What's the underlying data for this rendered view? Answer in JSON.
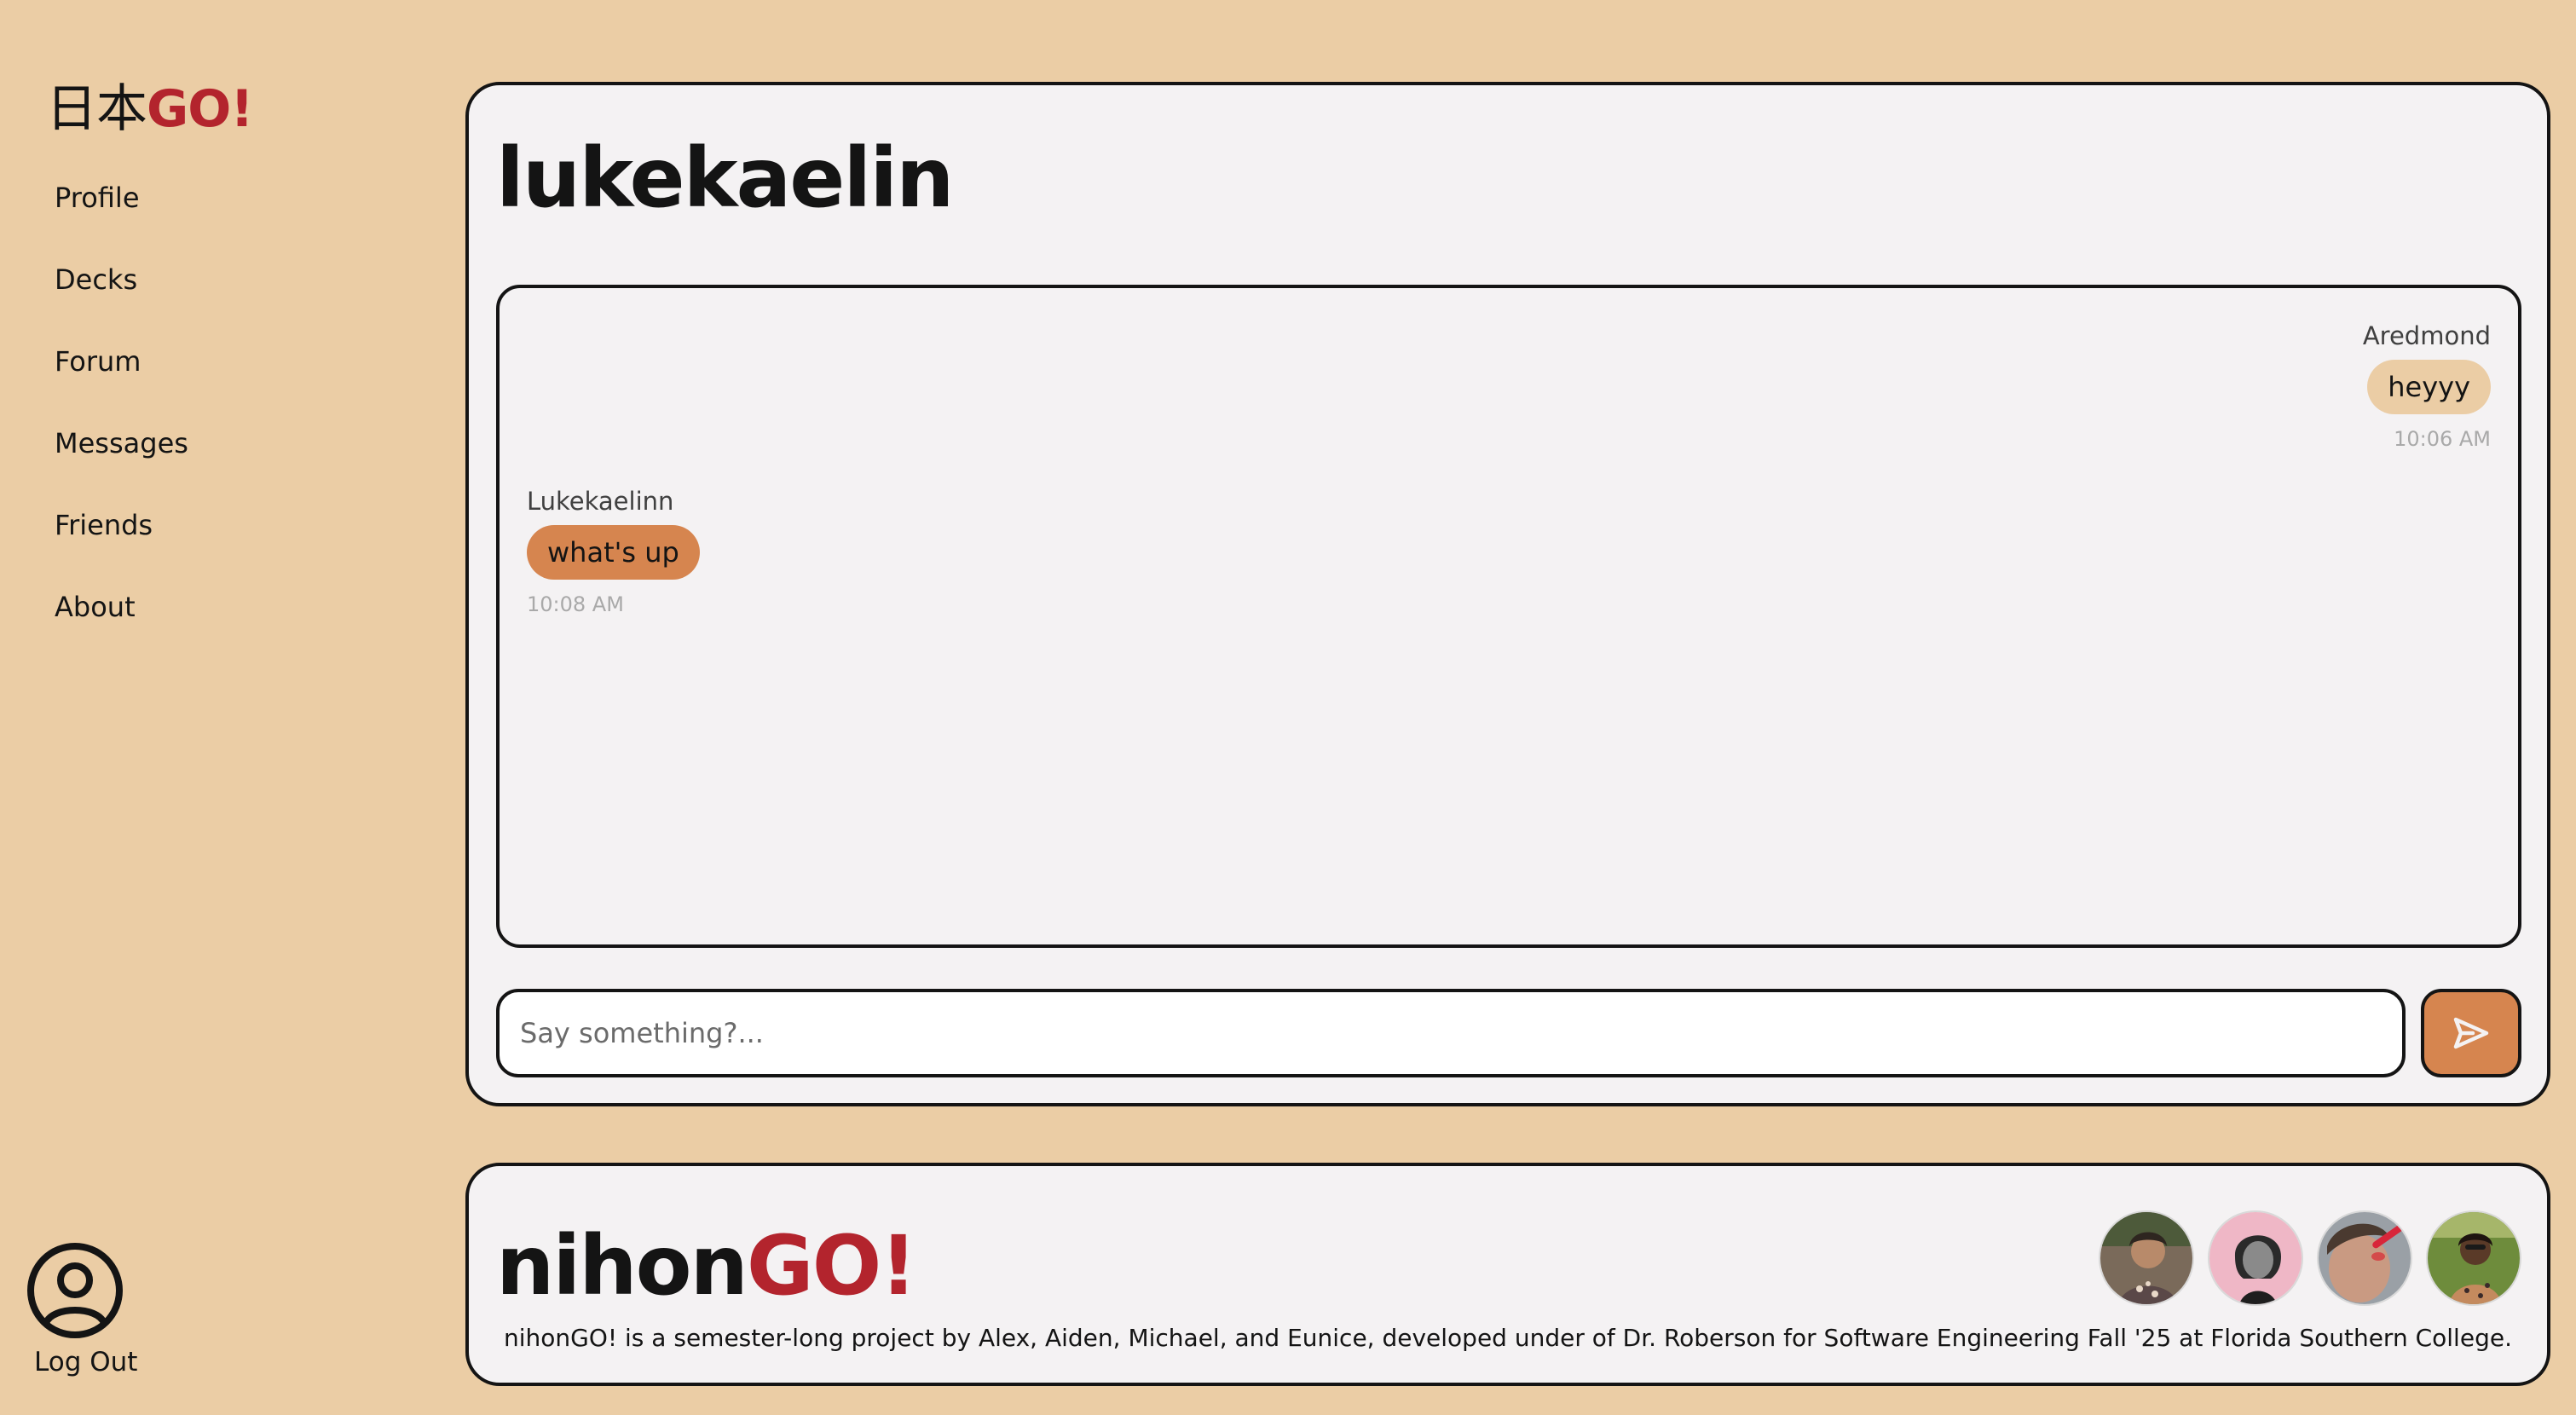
{
  "sidebar": {
    "logo": {
      "kanji": "日本",
      "go": "GO!"
    },
    "nav": [
      {
        "label": "Profile"
      },
      {
        "label": "Decks"
      },
      {
        "label": "Forum"
      },
      {
        "label": "Messages"
      },
      {
        "label": "Friends"
      },
      {
        "label": "About"
      }
    ],
    "logout_label": "Log Out",
    "logout_icon": "user-circle-icon"
  },
  "chat": {
    "title": "lukekaelin",
    "messages": [
      {
        "sender": "Aredmond",
        "text": "heyyy",
        "time": "10:06 AM",
        "side": "right"
      },
      {
        "sender": "Lukekaelinn",
        "text": "what's up",
        "time": "10:08 AM",
        "side": "left"
      }
    ],
    "input_placeholder": "Say something?...",
    "input_value": "",
    "send_icon": "send-icon"
  },
  "footer": {
    "brand_prefix": "nihon",
    "brand_go": "GO!",
    "description": "nihonGO! is a semester-long project by Alex, Aiden, Michael, and Eunice, developed under of Dr. Roberson for Software Engineering Fall '25 at Florida Southern College.",
    "avatars": [
      "team-member-avatar-1",
      "team-member-avatar-2",
      "team-member-avatar-3",
      "team-member-avatar-4"
    ]
  },
  "colors": {
    "background": "#ebcda5",
    "panel": "#f4f2f3",
    "accent_red": "#b3242d",
    "accent_orange": "#d6854f",
    "border": "#141414"
  }
}
